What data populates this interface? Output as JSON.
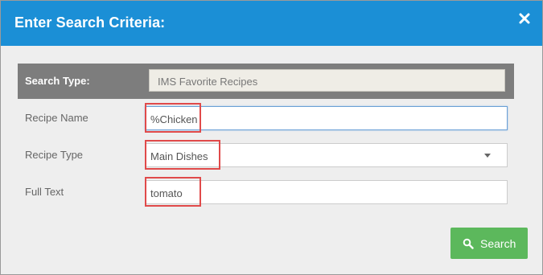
{
  "dialog": {
    "title": "Enter Search Criteria:",
    "close_icon": "close-icon"
  },
  "search_type": {
    "label": "Search Type:",
    "value": "IMS Favorite Recipes"
  },
  "recipe_name": {
    "label": "Recipe Name",
    "value": "%Chicken"
  },
  "recipe_type": {
    "label": "Recipe Type",
    "value": "Main Dishes"
  },
  "full_text": {
    "label": "Full Text",
    "value": "tomato"
  },
  "search_button": {
    "label": "Search",
    "icon": "search-icon",
    "color": "#5cb85c"
  },
  "colors": {
    "header": "#1b8fd6",
    "highlight": "#e04a4a"
  }
}
